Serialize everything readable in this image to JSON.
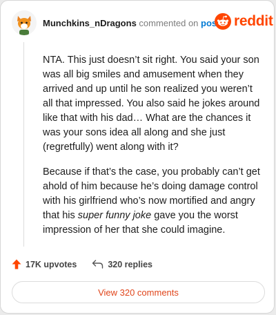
{
  "comment": {
    "username": "Munchkins_nDragons",
    "action_text": "commented on",
    "post_link": "post",
    "paragraphs": {
      "p1": "NTA. This just doesn’t sit right. You said your son was all big smiles and amusement when they arrived and up until he son realized you weren’t all that impressed. You also said he jokes around like that with his dad… What are the chances it was your sons idea all along and she just (regretfully) went along with it?",
      "p2_before": "Because if that’s the case, you probably can’t get ahold of him because he’s doing damage control with his girlfriend who’s now mortified and angry that his ",
      "p2_emphasis": "super funny joke",
      "p2_after": " gave you the worst impression of her that she could imagine."
    }
  },
  "brand": {
    "name": "reddit",
    "icon": "reddit-logo-icon",
    "color": "#ff4500"
  },
  "stats": {
    "upvotes": "17K upvotes",
    "upvote_icon": "upvote-arrow-icon",
    "replies": "320 replies",
    "reply_icon": "reply-arrow-icon"
  },
  "view_button": "View 320 comments",
  "colors": {
    "accent": "#ff4500",
    "link": "#0079d3"
  }
}
